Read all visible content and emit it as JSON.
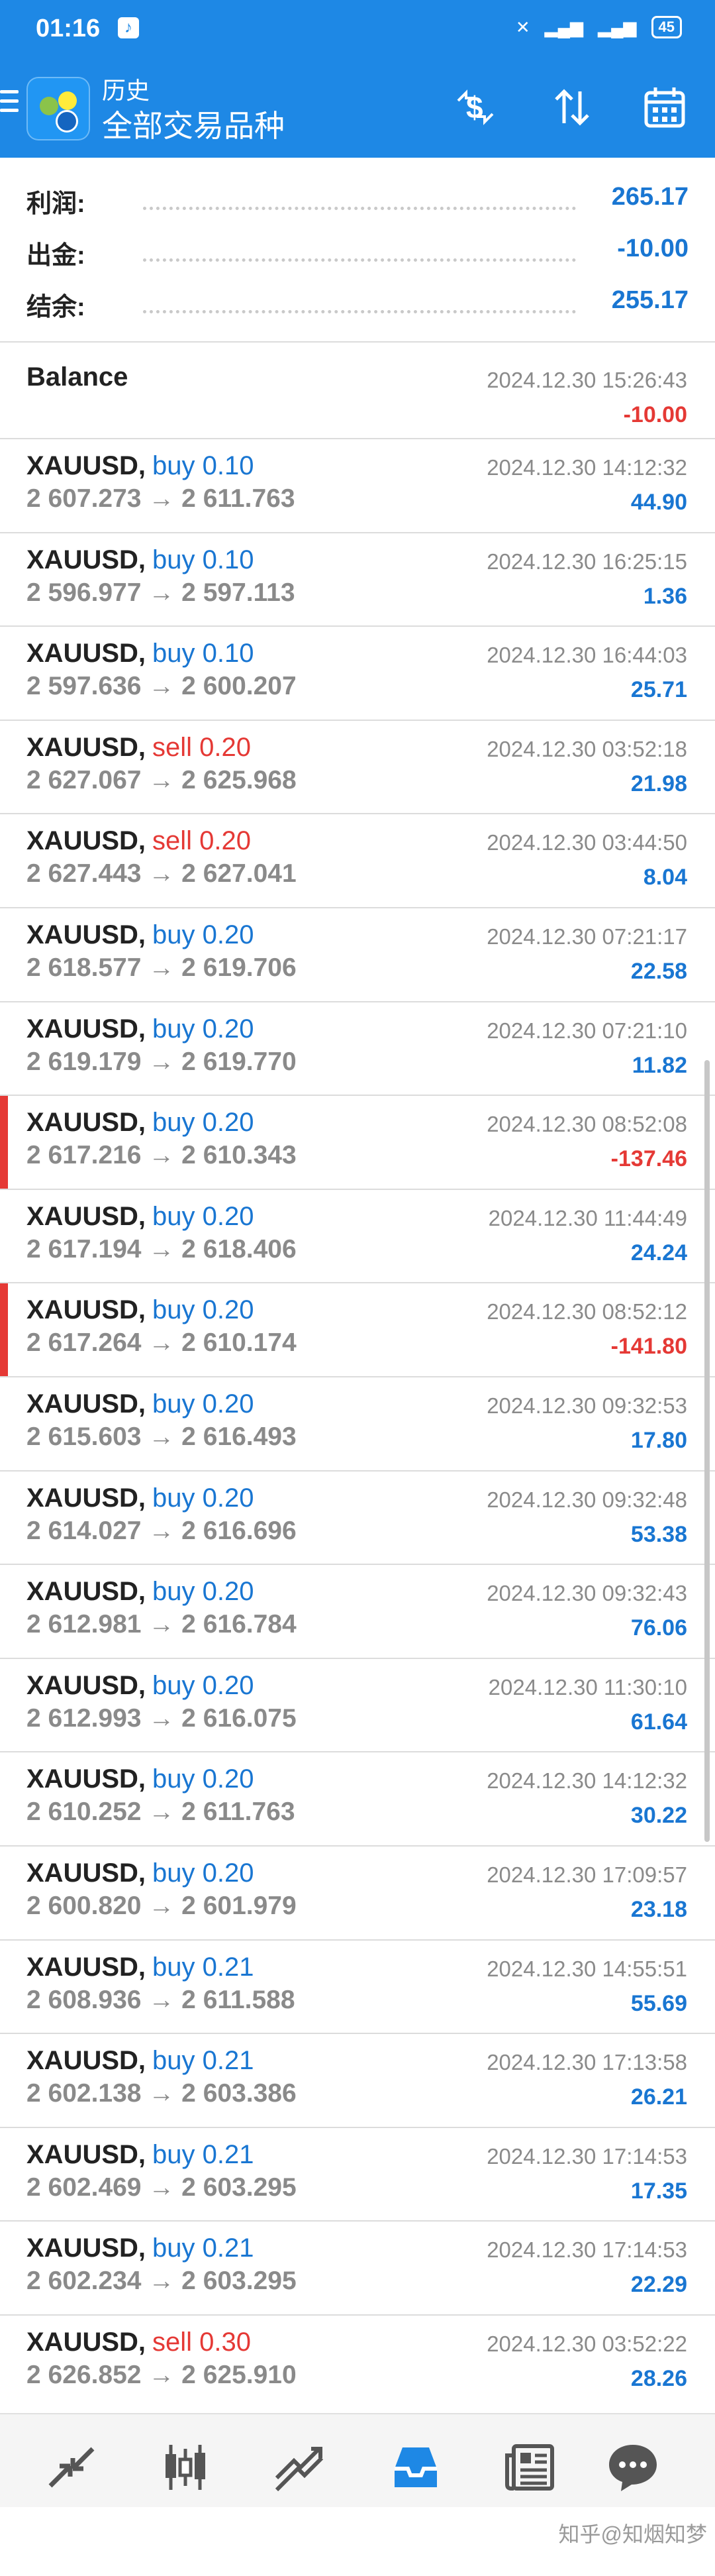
{
  "status_bar": {
    "time": "01:16",
    "battery": "45"
  },
  "app_bar": {
    "subtitle": "历史",
    "title": "全部交易品种",
    "icons": [
      "menu-icon",
      "app-logo",
      "dollar-switch-icon",
      "sort-icon",
      "calendar-icon"
    ]
  },
  "summary": [
    {
      "label": "利润:",
      "value": "265.17"
    },
    {
      "label": "出金:",
      "value": "-10.00"
    },
    {
      "label": "结余:",
      "value": "255.17"
    }
  ],
  "balance_entry": {
    "label": "Balance",
    "datetime": "2024.12.30 15:26:43",
    "amount": "-10.00"
  },
  "deals": [
    {
      "symbol": "XAUUSD,",
      "side": "buy 0.10",
      "prices": "2 607.273 → 2 611.763",
      "datetime": "2024.12.30 14:12:32",
      "profit": "44.90"
    },
    {
      "symbol": "XAUUSD,",
      "side": "buy 0.10",
      "prices": "2 596.977 → 2 597.113",
      "datetime": "2024.12.30 16:25:15",
      "profit": "1.36"
    },
    {
      "symbol": "XAUUSD,",
      "side": "buy 0.10",
      "prices": "2 597.636 → 2 600.207",
      "datetime": "2024.12.30 16:44:03",
      "profit": "25.71"
    },
    {
      "symbol": "XAUUSD,",
      "side": "sell 0.20",
      "prices": "2 627.067 → 2 625.968",
      "datetime": "2024.12.30 03:52:18",
      "profit": "21.98"
    },
    {
      "symbol": "XAUUSD,",
      "side": "sell 0.20",
      "prices": "2 627.443 → 2 627.041",
      "datetime": "2024.12.30 03:44:50",
      "profit": "8.04"
    },
    {
      "symbol": "XAUUSD,",
      "side": "buy 0.20",
      "prices": "2 618.577 → 2 619.706",
      "datetime": "2024.12.30 07:21:17",
      "profit": "22.58"
    },
    {
      "symbol": "XAUUSD,",
      "side": "buy 0.20",
      "prices": "2 619.179 → 2 619.770",
      "datetime": "2024.12.30 07:21:10",
      "profit": "11.82"
    },
    {
      "symbol": "XAUUSD,",
      "side": "buy 0.20",
      "prices": "2 617.216 → 2 610.343",
      "datetime": "2024.12.30 08:52:08",
      "profit": "-137.46"
    },
    {
      "symbol": "XAUUSD,",
      "side": "buy 0.20",
      "prices": "2 617.194 → 2 618.406",
      "datetime": "2024.12.30 11:44:49",
      "profit": "24.24"
    },
    {
      "symbol": "XAUUSD,",
      "side": "buy 0.20",
      "prices": "2 617.264 → 2 610.174",
      "datetime": "2024.12.30 08:52:12",
      "profit": "-141.80"
    },
    {
      "symbol": "XAUUSD,",
      "side": "buy 0.20",
      "prices": "2 615.603 → 2 616.493",
      "datetime": "2024.12.30 09:32:53",
      "profit": "17.80"
    },
    {
      "symbol": "XAUUSD,",
      "side": "buy 0.20",
      "prices": "2 614.027 → 2 616.696",
      "datetime": "2024.12.30 09:32:48",
      "profit": "53.38"
    },
    {
      "symbol": "XAUUSD,",
      "side": "buy 0.20",
      "prices": "2 612.981 → 2 616.784",
      "datetime": "2024.12.30 09:32:43",
      "profit": "76.06"
    },
    {
      "symbol": "XAUUSD,",
      "side": "buy 0.20",
      "prices": "2 612.993 → 2 616.075",
      "datetime": "2024.12.30 11:30:10",
      "profit": "61.64"
    },
    {
      "symbol": "XAUUSD,",
      "side": "buy 0.20",
      "prices": "2 610.252 → 2 611.763",
      "datetime": "2024.12.30 14:12:32",
      "profit": "30.22"
    },
    {
      "symbol": "XAUUSD,",
      "side": "buy 0.20",
      "prices": "2 600.820 → 2 601.979",
      "datetime": "2024.12.30 17:09:57",
      "profit": "23.18"
    },
    {
      "symbol": "XAUUSD,",
      "side": "buy 0.21",
      "prices": "2 608.936 → 2 611.588",
      "datetime": "2024.12.30 14:55:51",
      "profit": "55.69"
    },
    {
      "symbol": "XAUUSD,",
      "side": "buy 0.21",
      "prices": "2 602.138 → 2 603.386",
      "datetime": "2024.12.30 17:13:58",
      "profit": "26.21"
    },
    {
      "symbol": "XAUUSD,",
      "side": "buy 0.21",
      "prices": "2 602.469 → 2 603.295",
      "datetime": "2024.12.30 17:14:53",
      "profit": "17.35"
    },
    {
      "symbol": "XAUUSD,",
      "side": "buy 0.21",
      "prices": "2 602.234 → 2 603.295",
      "datetime": "2024.12.30 17:14:53",
      "profit": "22.29"
    },
    {
      "symbol": "XAUUSD,",
      "side": "sell 0.30",
      "prices": "2 626.852 → 2 625.910",
      "datetime": "2024.12.30 03:52:22",
      "profit": "28.26"
    }
  ],
  "bottom_nav": [
    "quotes-icon",
    "chart-icon",
    "trade-icon",
    "history-icon",
    "news-icon",
    "chat-icon"
  ],
  "colors": {
    "header_bg": "#1e88e5",
    "buy": "#1976d2",
    "sell": "#e53935",
    "profit": "#1976d2",
    "loss": "#e53935",
    "active_nav": "#1e88e5"
  },
  "watermark": "知乎@知烟知梦"
}
